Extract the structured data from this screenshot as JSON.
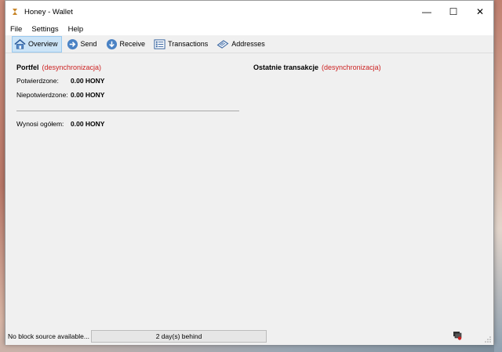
{
  "window": {
    "title": "Honey - Wallet",
    "controls": {
      "minimize": "—",
      "maximize": "☐",
      "close": "✕"
    }
  },
  "menu": [
    "File",
    "Settings",
    "Help"
  ],
  "toolbar": [
    {
      "label": "Overview",
      "icon": "home-icon",
      "active": true
    },
    {
      "label": "Send",
      "icon": "send-icon",
      "active": false
    },
    {
      "label": "Receive",
      "icon": "receive-icon",
      "active": false
    },
    {
      "label": "Transactions",
      "icon": "list-icon",
      "active": false
    },
    {
      "label": "Addresses",
      "icon": "address-book-icon",
      "active": false
    }
  ],
  "wallet": {
    "heading": "Portfel",
    "sync_status": "(desynchronizacja)",
    "confirmed_label": "Potwierdzone:",
    "confirmed_value": "0.00 HONY",
    "unconfirmed_label": "Niepotwierdzone:",
    "unconfirmed_value": "0.00 HONY",
    "total_label": "Wynosi ogółem:",
    "total_value": "0.00 HONY"
  },
  "recent": {
    "heading": "Ostatnie transakcje",
    "sync_status": "(desynchronizacja)"
  },
  "status": {
    "source": "No block source available...",
    "progress_text": "2 day(s) behind",
    "sync_icon": "network-sync-warning-icon"
  },
  "colors": {
    "warning": "#cc2222",
    "active_tab_bg": "#cce4f7"
  }
}
